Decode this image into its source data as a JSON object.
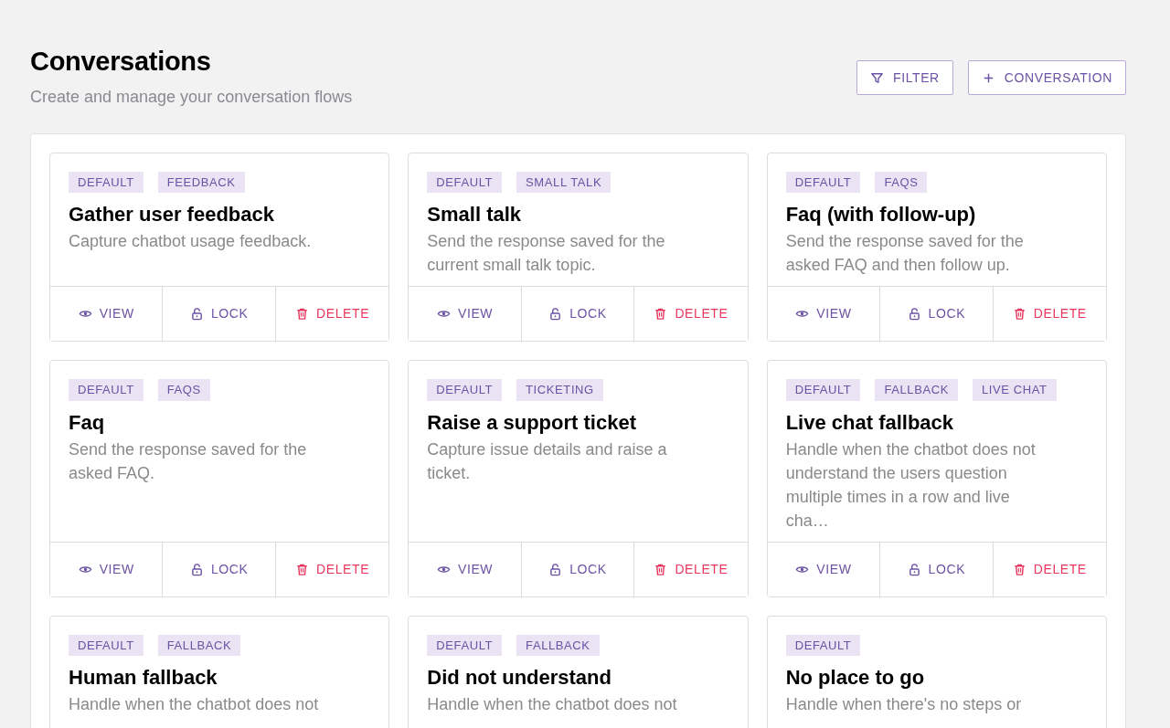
{
  "header": {
    "title": "Conversations",
    "subtitle": "Create and manage your conversation flows"
  },
  "toolbar": [
    {
      "kind": "filter",
      "label": "FILTER"
    },
    {
      "kind": "add",
      "label": "CONVERSATION"
    }
  ],
  "cards": [
    {
      "tags": [
        "DEFAULT",
        "FEEDBACK"
      ],
      "title": "Gather user feedback",
      "description": "Capture chatbot usage feedback.",
      "actions": [
        {
          "kind": "view",
          "label": "VIEW"
        },
        {
          "kind": "lock",
          "label": "LOCK"
        },
        {
          "kind": "delete",
          "label": "DELETE"
        }
      ]
    },
    {
      "tags": [
        "DEFAULT",
        "SMALL TALK"
      ],
      "title": "Small talk",
      "description": "Send the response saved for the current small talk topic.",
      "actions": [
        {
          "kind": "view",
          "label": "VIEW"
        },
        {
          "kind": "lock",
          "label": "LOCK"
        },
        {
          "kind": "delete",
          "label": "DELETE"
        }
      ]
    },
    {
      "tags": [
        "DEFAULT",
        "FAQS"
      ],
      "title": "Faq (with follow-up)",
      "description": "Send the response saved for the asked FAQ and then follow up.",
      "actions": [
        {
          "kind": "view",
          "label": "VIEW"
        },
        {
          "kind": "lock",
          "label": "LOCK"
        },
        {
          "kind": "delete",
          "label": "DELETE"
        }
      ]
    },
    {
      "tags": [
        "DEFAULT",
        "FAQS"
      ],
      "title": "Faq",
      "description": "Send the response saved for the asked FAQ.",
      "actions": [
        {
          "kind": "view",
          "label": "VIEW"
        },
        {
          "kind": "lock",
          "label": "LOCK"
        },
        {
          "kind": "delete",
          "label": "DELETE"
        }
      ]
    },
    {
      "tags": [
        "DEFAULT",
        "TICKETING"
      ],
      "title": "Raise a support ticket",
      "description": "Capture issue details and raise a ticket.",
      "actions": [
        {
          "kind": "view",
          "label": "VIEW"
        },
        {
          "kind": "lock",
          "label": "LOCK"
        },
        {
          "kind": "delete",
          "label": "DELETE"
        }
      ]
    },
    {
      "tags": [
        "DEFAULT",
        "FALLBACK",
        "LIVE CHAT"
      ],
      "title": "Live chat fallback",
      "description": "Handle when the chatbot does not understand the users question multiple times in a row and live cha…",
      "actions": [
        {
          "kind": "view",
          "label": "VIEW"
        },
        {
          "kind": "lock",
          "label": "LOCK"
        },
        {
          "kind": "delete",
          "label": "DELETE"
        }
      ]
    },
    {
      "tags": [
        "DEFAULT",
        "FALLBACK"
      ],
      "title": "Human fallback",
      "description": "Handle when the chatbot does not"
    },
    {
      "tags": [
        "DEFAULT",
        "FALLBACK"
      ],
      "title": "Did not understand",
      "description": "Handle when the chatbot does not"
    },
    {
      "tags": [
        "DEFAULT"
      ],
      "title": "No place to go",
      "description": "Handle when there's no steps or"
    }
  ]
}
